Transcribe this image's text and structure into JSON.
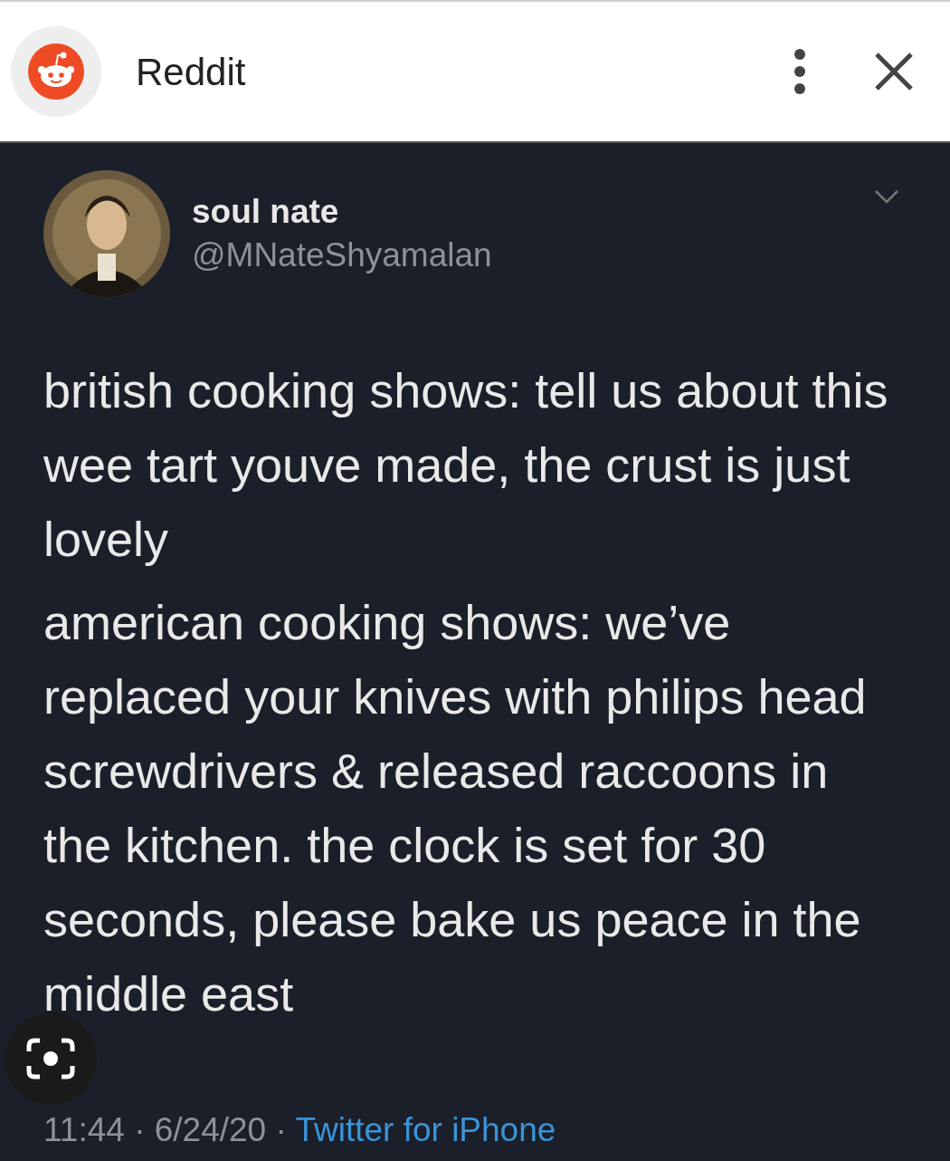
{
  "header": {
    "title": "Reddit"
  },
  "tweet": {
    "name": "soul nate",
    "handle": "@MNateShyamalan",
    "paragraphs": [
      "british cooking shows: tell us about this wee tart youve made, the crust is just lovely",
      "american cooking shows: we’ve replaced your knives with philips head screwdrivers & released raccoons in the kitchen. the clock is set for 30 seconds, please bake us peace in the middle east"
    ],
    "time": "11:44",
    "sep1": "·",
    "date": "6/24/20",
    "sep2": "·",
    "source": "Twitter for iPhone"
  }
}
